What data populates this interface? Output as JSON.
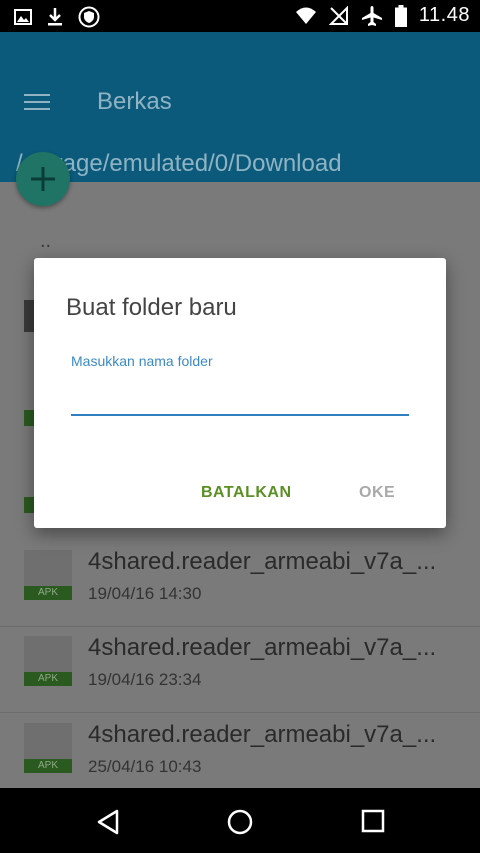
{
  "status_bar": {
    "time": "11.48"
  },
  "app_bar": {
    "title": "Berkas",
    "path": "/storage/emulated/0/Download"
  },
  "list": {
    "up_dir": "..",
    "apk_tag": "APK",
    "items": [
      {
        "name": "4shared.reader_armeabi_v7a_...",
        "date": "19/04/16 14:30"
      },
      {
        "name": "4shared.reader_armeabi_v7a_...",
        "date": "19/04/16 23:34"
      },
      {
        "name": "4shared.reader_armeabi_v7a_...",
        "date": "25/04/16 10:43"
      }
    ]
  },
  "dialog": {
    "title": "Buat folder baru",
    "field_label": "Masukkan nama folder",
    "field_value": "",
    "cancel_label": "BATALKAN",
    "ok_label": "OKE"
  },
  "icons": {
    "status_left": [
      "image-icon",
      "download-icon",
      "vpn-shield-icon"
    ],
    "status_right": [
      "wifi-icon",
      "no-sim-icon",
      "airplane-icon",
      "battery-icon"
    ],
    "fab": "plus-icon",
    "nav": [
      "back-icon",
      "home-icon",
      "recents-icon"
    ]
  },
  "colors": {
    "accent_blue": "#2f7fc1",
    "accent_green": "#5a8f24",
    "app_bar": "#1a9bd0"
  }
}
